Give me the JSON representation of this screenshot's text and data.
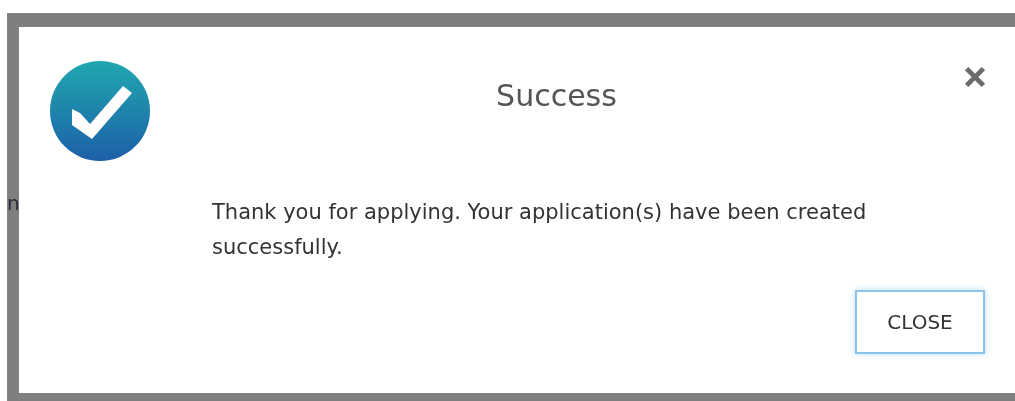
{
  "background": {
    "fragment": "n"
  },
  "dialog": {
    "title": "Success",
    "message": "Thank you for applying. Your application(s) have been created successfully.",
    "close_button": "CLOSE"
  }
}
